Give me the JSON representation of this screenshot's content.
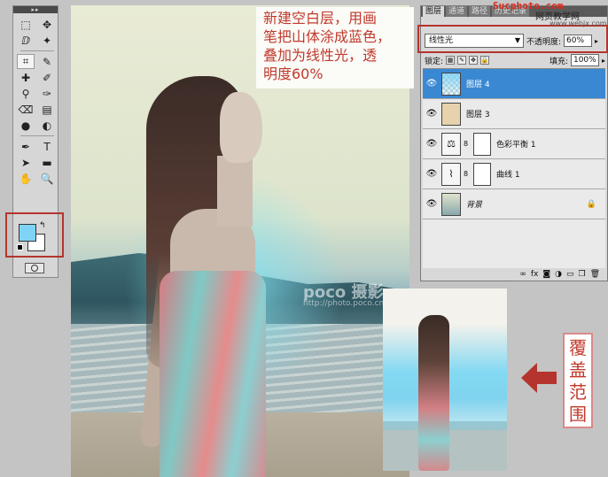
{
  "callout": {
    "lines": [
      "新建空白层，用画",
      "笔把山体涂成蓝色，",
      "叠加为线性光，透",
      "明度60%"
    ]
  },
  "toolbox": {
    "title": "▸▸",
    "tools": [
      {
        "icon": "⬚",
        "name": "marquee-tool-icon"
      },
      {
        "icon": "✥",
        "name": "move-tool-icon"
      },
      {
        "icon": "ⅅ",
        "name": "lasso-tool-icon"
      },
      {
        "icon": "✦",
        "name": "magic-wand-icon"
      },
      {
        "icon": "⌗",
        "name": "crop-tool-icon"
      },
      {
        "icon": "✎",
        "name": "eyedropper-icon"
      },
      {
        "icon": "✚",
        "name": "healing-brush-icon"
      },
      {
        "icon": "✐",
        "name": "brush-tool-icon"
      },
      {
        "icon": "⚲",
        "name": "clone-stamp-icon"
      },
      {
        "icon": "✑",
        "name": "history-brush-icon"
      },
      {
        "icon": "⌫",
        "name": "eraser-icon"
      },
      {
        "icon": "▤",
        "name": "gradient-tool-icon"
      },
      {
        "icon": "●",
        "name": "blur-tool-icon"
      },
      {
        "icon": "◐",
        "name": "dodge-tool-icon"
      },
      {
        "icon": "✒",
        "name": "pen-tool-icon"
      },
      {
        "icon": "T",
        "name": "type-tool-icon"
      },
      {
        "icon": "➤",
        "name": "path-selection-icon"
      },
      {
        "icon": "▬",
        "name": "shape-tool-icon"
      },
      {
        "icon": "✋",
        "name": "hand-tool-icon"
      },
      {
        "icon": "🔍",
        "name": "zoom-tool-icon"
      }
    ],
    "foreground_color": "#7fd4f5",
    "background_color": "#ffffff",
    "swap_icon": "↰"
  },
  "layers_panel": {
    "tabs": [
      "图层",
      "通道",
      "路径",
      "历史记录"
    ],
    "blend_mode": "线性光",
    "opacity_label": "不透明度:",
    "opacity_value": "60%",
    "lock_label": "锁定:",
    "fill_label": "填充:",
    "fill_value": "100%",
    "layers": [
      {
        "name": "图层 4",
        "selected": true
      },
      {
        "name": "图层 3",
        "selected": false
      },
      {
        "name": "色彩平衡 1",
        "selected": false
      },
      {
        "name": "曲线 1",
        "selected": false
      },
      {
        "name": "背景",
        "selected": false
      }
    ],
    "bottom_icons": [
      "∞",
      "fx",
      "◙",
      "◑",
      "▭",
      "❒",
      "🗑"
    ]
  },
  "logo": {
    "brand": "Sucphoto.com",
    "site": "网页教学网",
    "url": "www.webjx.com"
  },
  "watermark": {
    "brand": "poco 摄影",
    "url": "http://photo.poco.cn"
  },
  "side_label": [
    "覆",
    "盖",
    "范",
    "围"
  ],
  "colors": {
    "accent_red": "#b5342e",
    "callout_text": "#c0392b",
    "selected_layer": "#3a88d2"
  }
}
